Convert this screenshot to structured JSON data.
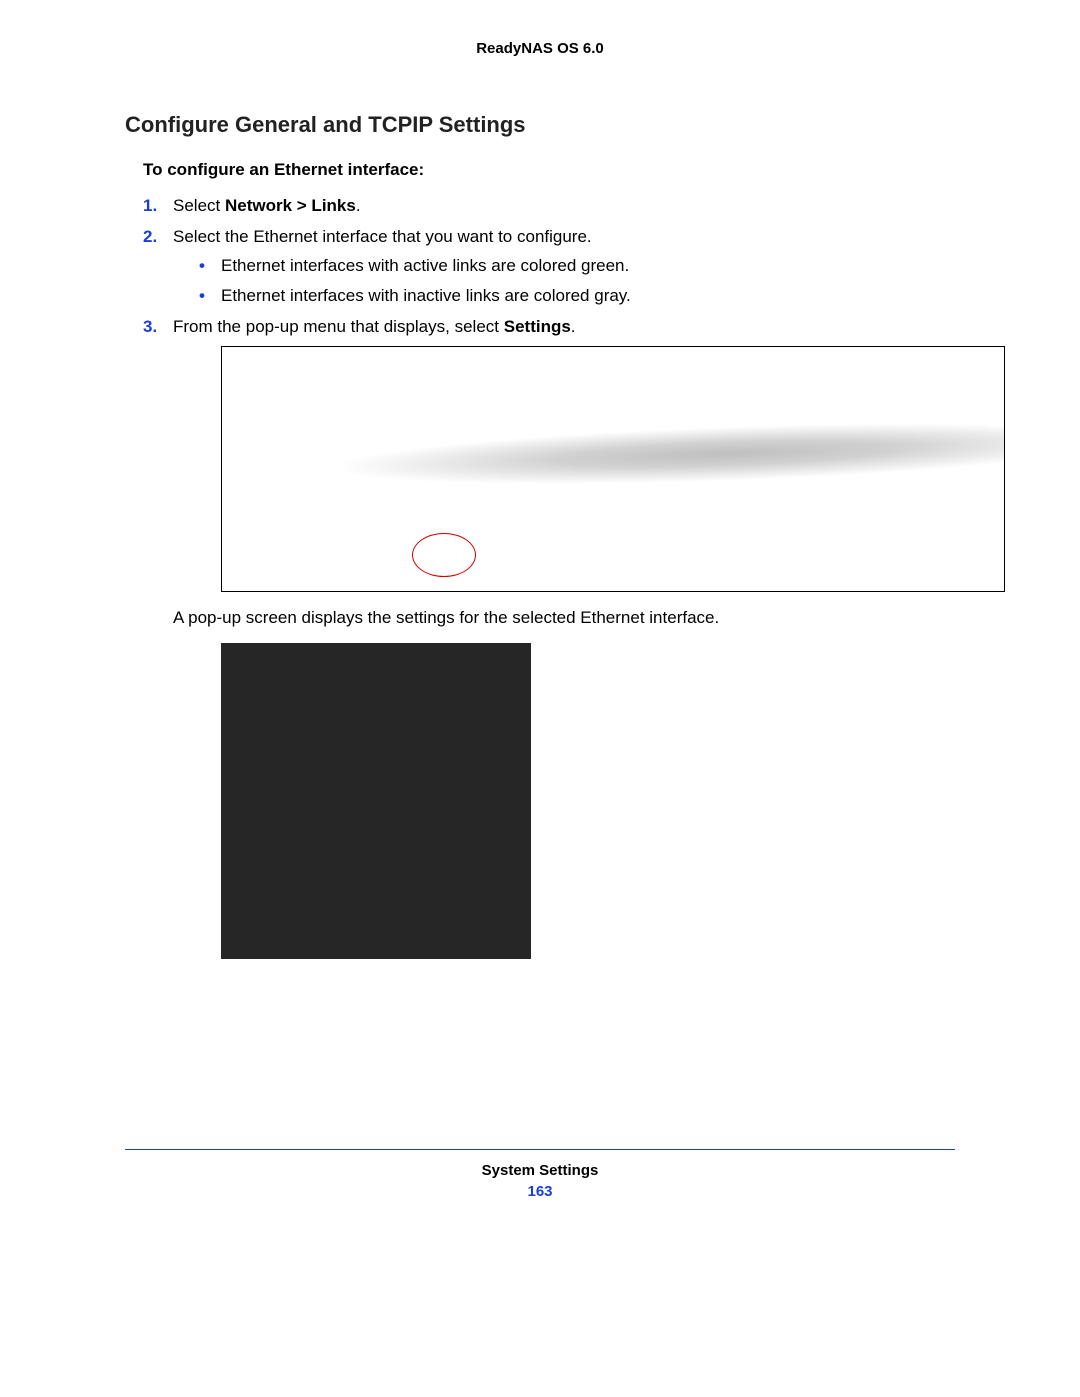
{
  "header": {
    "product": "ReadyNAS OS 6.0"
  },
  "section": {
    "title": "Configure General and TCPIP Settings"
  },
  "leadIn": "To configure an Ethernet interface:",
  "steps": [
    {
      "num": "1.",
      "pre": "Select ",
      "bold": "Network > Links",
      "post": "."
    },
    {
      "num": "2.",
      "pre": "Select the Ethernet interface that you want to configure.",
      "bullets": [
        "Ethernet interfaces with active links are colored green.",
        "Ethernet interfaces with inactive links are colored gray."
      ]
    },
    {
      "num": "3.",
      "pre": "From the pop-up menu that displays, select ",
      "bold": "Settings",
      "post": "."
    }
  ],
  "afterFig1": "A pop-up screen displays the settings for the selected Ethernet interface.",
  "footer": {
    "chapter": "System Settings",
    "page": "163"
  }
}
